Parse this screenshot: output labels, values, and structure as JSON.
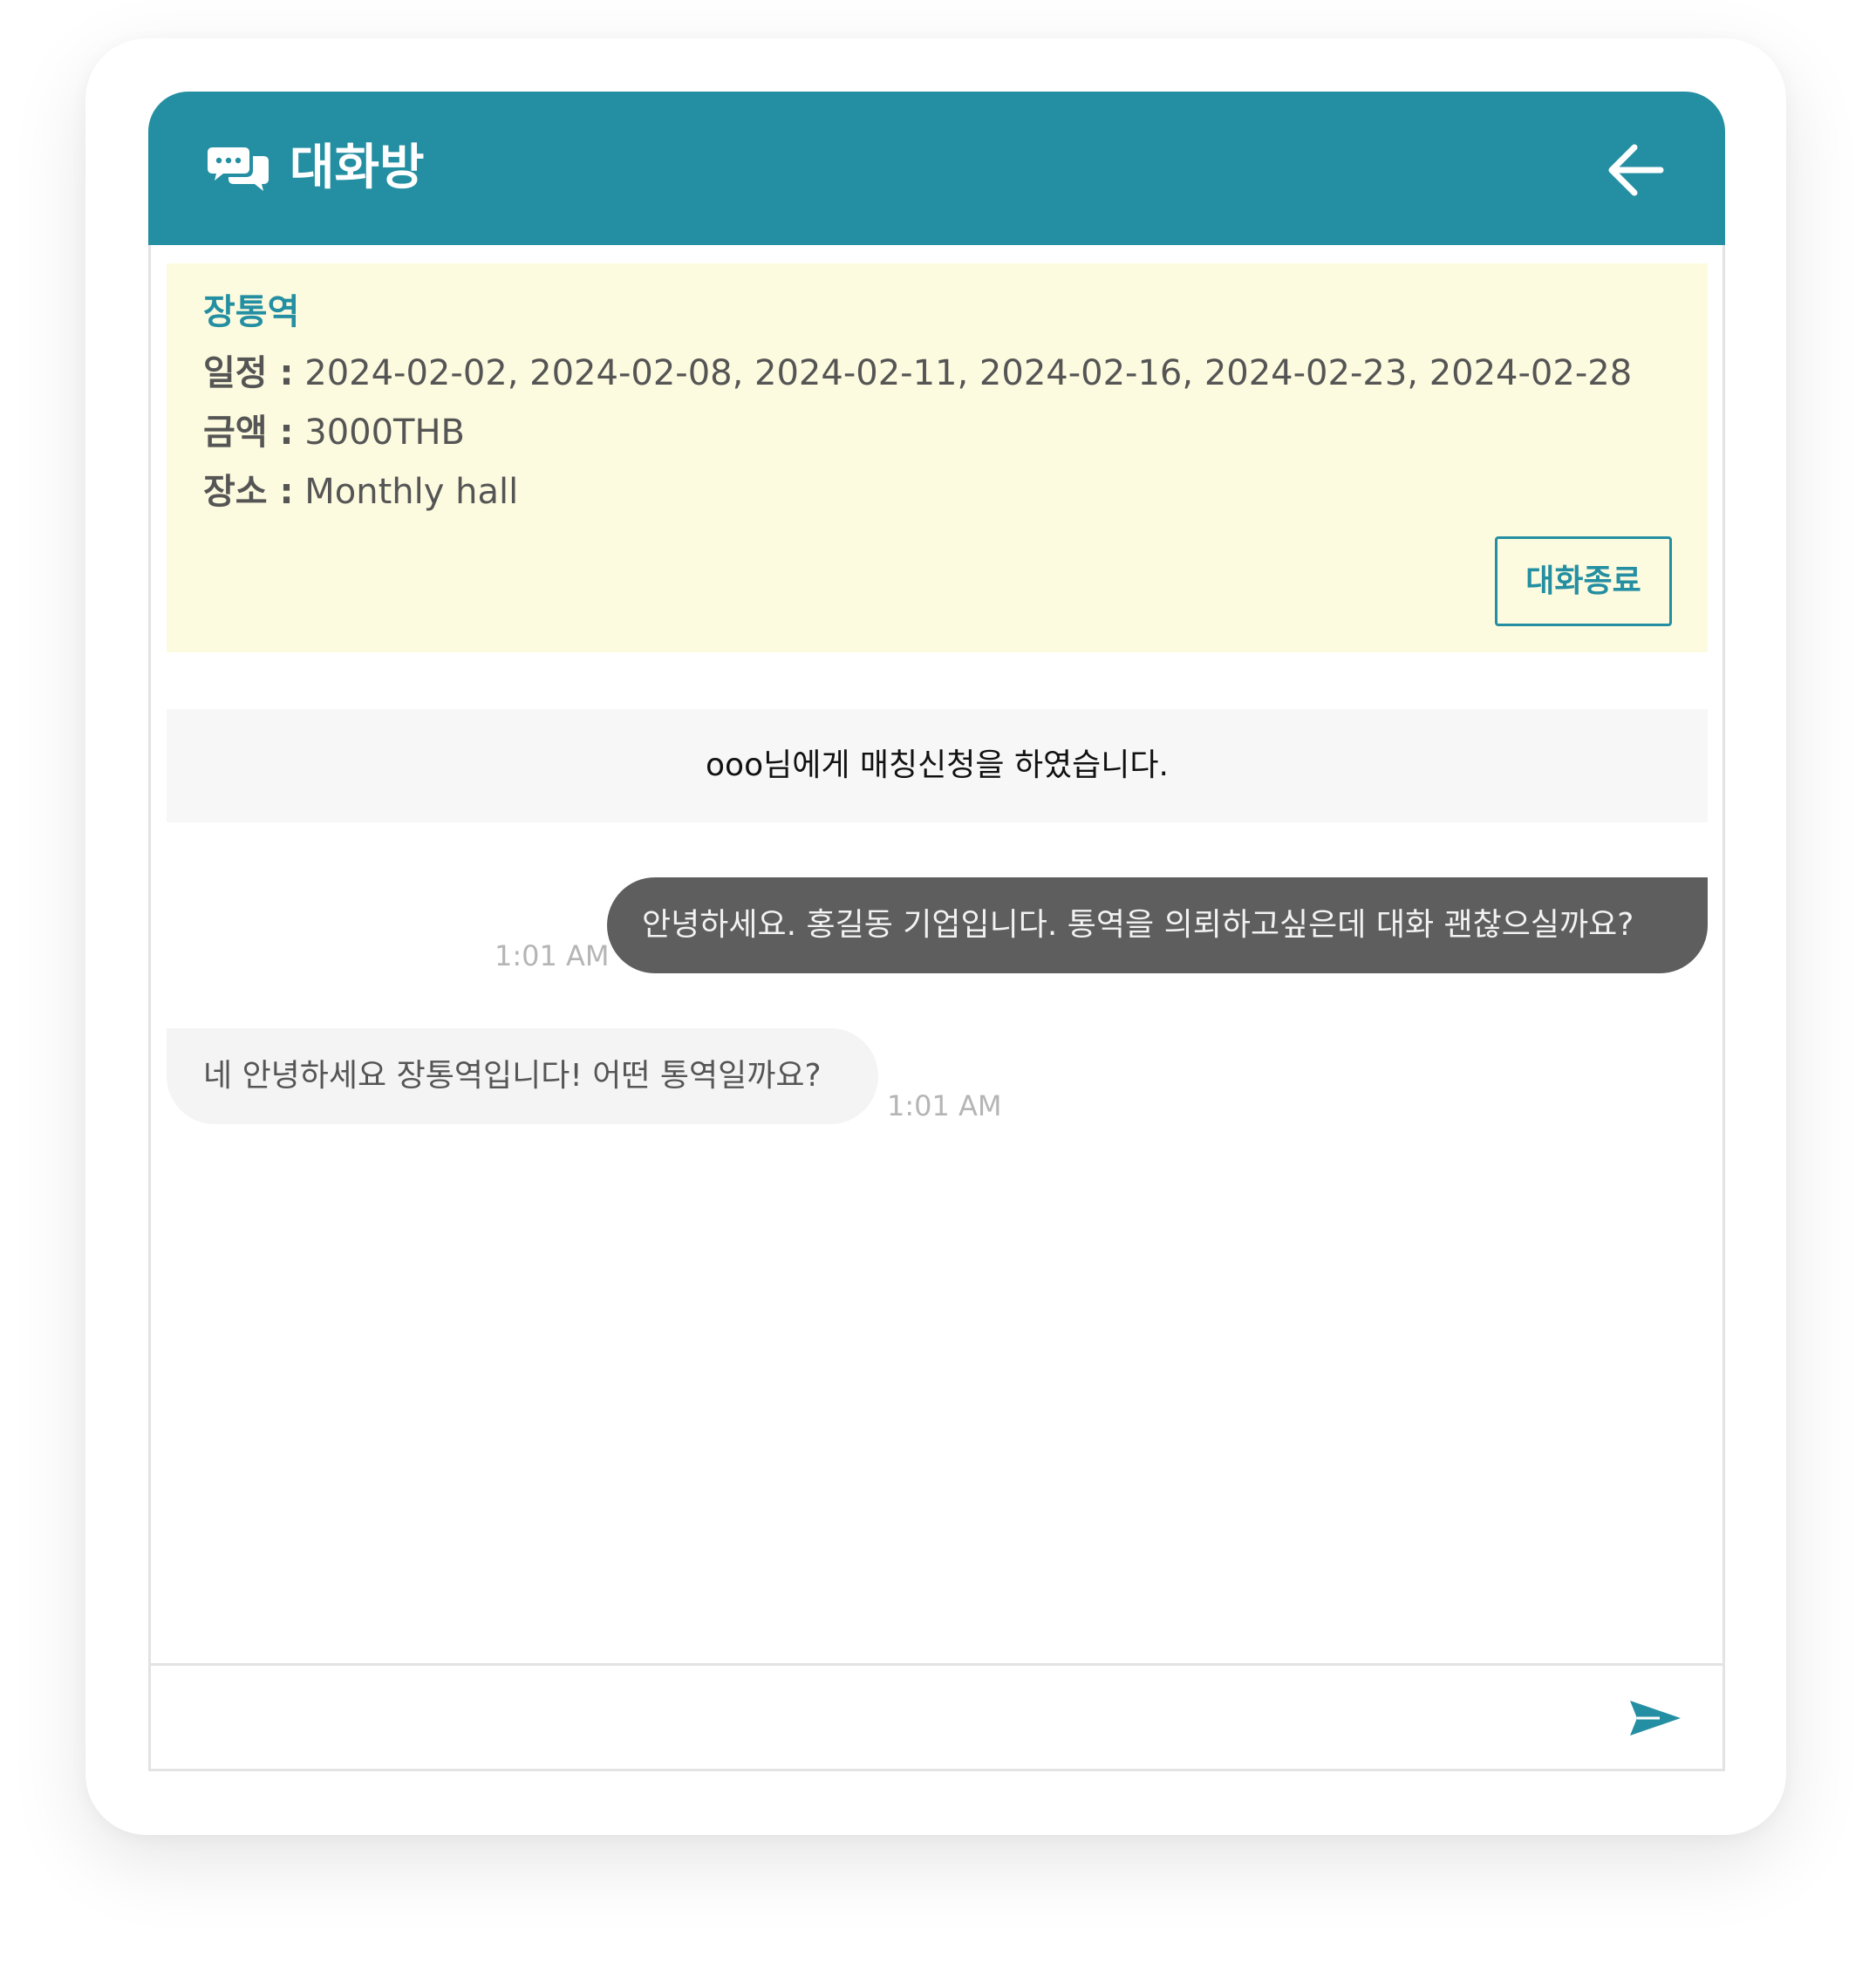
{
  "header": {
    "title": "대화방",
    "icon": "chat-bubbles-icon",
    "back_icon": "arrow-left-icon",
    "color": "#248fa2"
  },
  "info": {
    "name": "장통역",
    "schedule_label": "일정 :",
    "schedule_value": "2024-02-02, 2024-02-08, 2024-02-11, 2024-02-16, 2024-02-23, 2024-02-28",
    "amount_label": "금액 :",
    "amount_value": "3000THB",
    "place_label": "장소 :",
    "place_value": "Monthly hall",
    "end_button_label": "대화종료",
    "background": "#fdfbdf"
  },
  "notice": {
    "text": "ooo님에게 매칭신청을 하였습니다."
  },
  "messages": [
    {
      "side": "right",
      "text": "안녕하세요. 홍길동 기업입니다. 통역을 의뢰하고싶은데 대화 괜찮으실까요?",
      "time": "1:01 AM"
    },
    {
      "side": "left",
      "text": "네 안녕하세요 장통역입니다! 어떤 통역일까요?",
      "time": "1:01 AM"
    }
  ],
  "composer": {
    "value": "",
    "send_icon": "send-icon"
  }
}
